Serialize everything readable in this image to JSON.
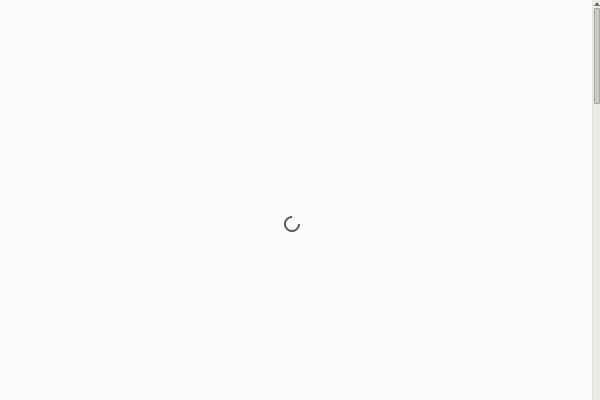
{
  "page": {
    "background": "#fafafa",
    "state": "loading"
  },
  "spinner": {
    "icon": "loading-spinner-icon",
    "color": "#5a5a5a"
  },
  "scrollbar": {
    "track_color": "#ecebe8",
    "thumb_color": "#c9c8c4",
    "up_icon": "triangle-up-icon"
  }
}
